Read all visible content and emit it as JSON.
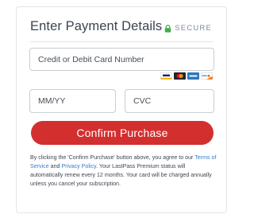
{
  "header": {
    "title": "Enter Payment Details",
    "secure_label": "SECURE",
    "secure_icon": "lock-icon",
    "secure_color": "#3fae49"
  },
  "form": {
    "card_number_placeholder": "Credit or Debit Card Number",
    "expiry_placeholder": "MM/YY",
    "cvc_placeholder": "CVC",
    "accepted_cards": [
      "visa-card-icon",
      "mastercard-card-icon",
      "amex-card-icon",
      "discover-card-icon"
    ]
  },
  "actions": {
    "confirm_label": "Confirm Purchase",
    "confirm_color": "#d32f2f"
  },
  "terms": {
    "part1": "By clicking the 'Confirm Purchase' button above, you agree to our ",
    "terms_link": "Terms of Service",
    "part2": " and ",
    "privacy_link": "Privacy Policy",
    "part3": ". Your LastPass Premium status will automatically renew every 12 months. Your card will be charged annually unless you cancel your subscription.",
    "link_color": "#2f7fd1"
  }
}
